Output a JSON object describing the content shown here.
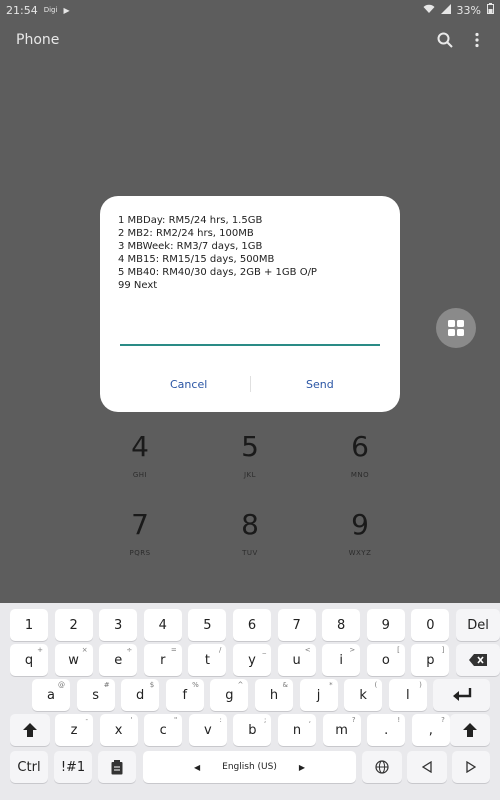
{
  "status": {
    "time": "21:54",
    "carrier": "Digi",
    "battery": "33%"
  },
  "app": {
    "title": "Phone"
  },
  "dialog": {
    "lines": [
      "1 MBDay: RM5/24 hrs, 1.5GB",
      "2 MB2: RM2/24 hrs, 100MB",
      "3 MBWeek: RM3/7 days, 1GB",
      "4 MB15: RM15/15 days, 500MB",
      "5 MB40: RM40/30 days, 2GB + 1GB O/P",
      "99 Next"
    ],
    "input_value": "",
    "cancel_label": "Cancel",
    "send_label": "Send"
  },
  "dialpad": {
    "keys": [
      {
        "num": "4",
        "letters": "GHI"
      },
      {
        "num": "5",
        "letters": "JKL"
      },
      {
        "num": "6",
        "letters": "MNO"
      },
      {
        "num": "7",
        "letters": "PQRS"
      },
      {
        "num": "8",
        "letters": "TUV"
      },
      {
        "num": "9",
        "letters": "WXYZ"
      }
    ]
  },
  "keyboard": {
    "number_row": [
      "1",
      "2",
      "3",
      "4",
      "5",
      "6",
      "7",
      "8",
      "9",
      "0"
    ],
    "del_label": "Del",
    "row1": [
      {
        "k": "q",
        "a": "+"
      },
      {
        "k": "w",
        "a": "×"
      },
      {
        "k": "e",
        "a": "÷"
      },
      {
        "k": "r",
        "a": "="
      },
      {
        "k": "t",
        "a": "/"
      },
      {
        "k": "y",
        "a": "_"
      },
      {
        "k": "u",
        "a": "<"
      },
      {
        "k": "i",
        "a": ">"
      },
      {
        "k": "o",
        "a": "["
      },
      {
        "k": "p",
        "a": "]"
      }
    ],
    "row2": [
      {
        "k": "a",
        "a": "@"
      },
      {
        "k": "s",
        "a": "#"
      },
      {
        "k": "d",
        "a": "$"
      },
      {
        "k": "f",
        "a": "%"
      },
      {
        "k": "g",
        "a": "^"
      },
      {
        "k": "h",
        "a": "&"
      },
      {
        "k": "j",
        "a": "*"
      },
      {
        "k": "k",
        "a": "("
      },
      {
        "k": "l",
        "a": ")"
      }
    ],
    "row3": [
      {
        "k": "z",
        "a": "-"
      },
      {
        "k": "x",
        "a": "'"
      },
      {
        "k": "c",
        "a": "\""
      },
      {
        "k": "v",
        "a": ":"
      },
      {
        "k": "b",
        "a": ";"
      },
      {
        "k": "n",
        "a": ","
      },
      {
        "k": "m",
        "a": "?"
      }
    ],
    "row3_extra": [
      {
        "k": ".",
        "a": "!"
      },
      {
        "k": ",",
        "a": "?"
      }
    ],
    "ctrl_label": "Ctrl",
    "sym_label": "!#1",
    "space_label": "English (US)",
    "colors": {
      "bg": "#e9e9ec",
      "key": "#ffffff",
      "accent": "#2a8b86",
      "link": "#2a55a4"
    }
  }
}
